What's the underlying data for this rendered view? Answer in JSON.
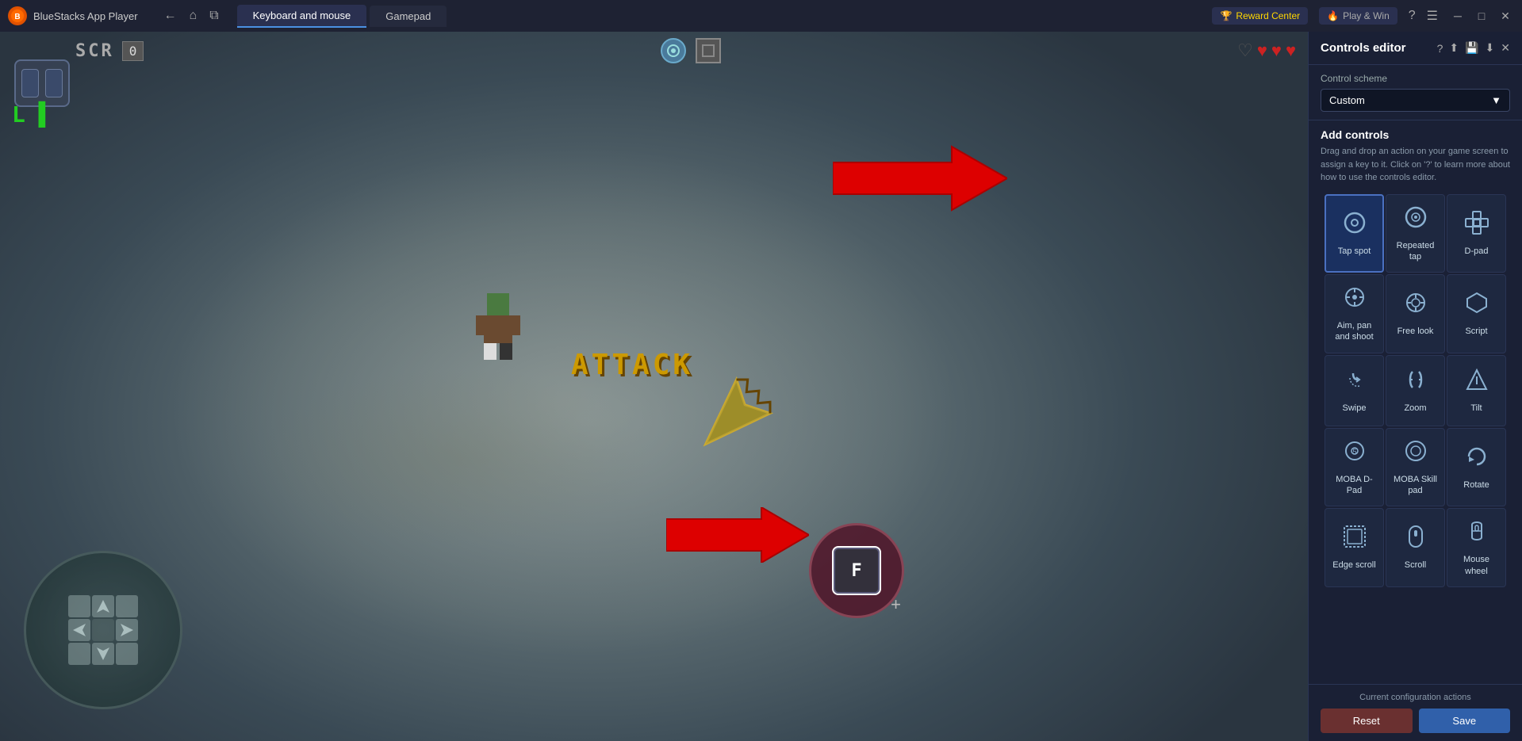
{
  "app": {
    "name": "BlueStacks App Player",
    "logo": "B"
  },
  "titlebar": {
    "tabs": [
      {
        "id": "keyboard",
        "label": "Keyboard and mouse",
        "active": true
      },
      {
        "id": "gamepad",
        "label": "Gamepad",
        "active": false
      }
    ],
    "reward_btn": "Reward Center",
    "playwn_btn": "Play & Win"
  },
  "game": {
    "hud": {
      "score_label": "SCR",
      "score_value": "0",
      "hearts": [
        "full",
        "full",
        "full",
        "empty"
      ]
    },
    "attack_text": "ATTACK"
  },
  "panel": {
    "title": "Controls editor",
    "control_scheme_label": "Control scheme",
    "scheme_value": "Custom",
    "add_controls_title": "Add controls",
    "add_controls_desc": "Drag and drop an action on your game screen to assign a key to it. Click on '?' to learn more about how to use the controls editor.",
    "controls": [
      {
        "id": "tap_spot",
        "label": "Tap spot",
        "icon": "○",
        "selected": true
      },
      {
        "id": "repeated_tap",
        "label": "Repeated tap",
        "icon": "◎"
      },
      {
        "id": "dpad",
        "label": "D-pad",
        "icon": "✛"
      },
      {
        "id": "aim_pan_shoot",
        "label": "Aim, pan and shoot",
        "icon": "⊕"
      },
      {
        "id": "free_look",
        "label": "Free look",
        "icon": "◈"
      },
      {
        "id": "script",
        "label": "Script",
        "icon": "⬡"
      },
      {
        "id": "swipe",
        "label": "Swipe",
        "icon": "☞"
      },
      {
        "id": "zoom",
        "label": "Zoom",
        "icon": "⊙"
      },
      {
        "id": "tilt",
        "label": "Tilt",
        "icon": "⬠"
      },
      {
        "id": "moba_dpad",
        "label": "MOBA D-Pad",
        "icon": "⊛"
      },
      {
        "id": "moba_skill",
        "label": "MOBA Skill pad",
        "icon": "◯"
      },
      {
        "id": "rotate",
        "label": "Rotate",
        "icon": "↻"
      },
      {
        "id": "edge_scroll",
        "label": "Edge scroll",
        "icon": "▣"
      },
      {
        "id": "scroll",
        "label": "Scroll",
        "icon": "▤"
      },
      {
        "id": "mouse_wheel",
        "label": "Mouse wheel",
        "icon": "🖱"
      }
    ],
    "config_actions_label": "Current configuration actions",
    "reset_btn": "Reset",
    "save_btn": "Save"
  }
}
